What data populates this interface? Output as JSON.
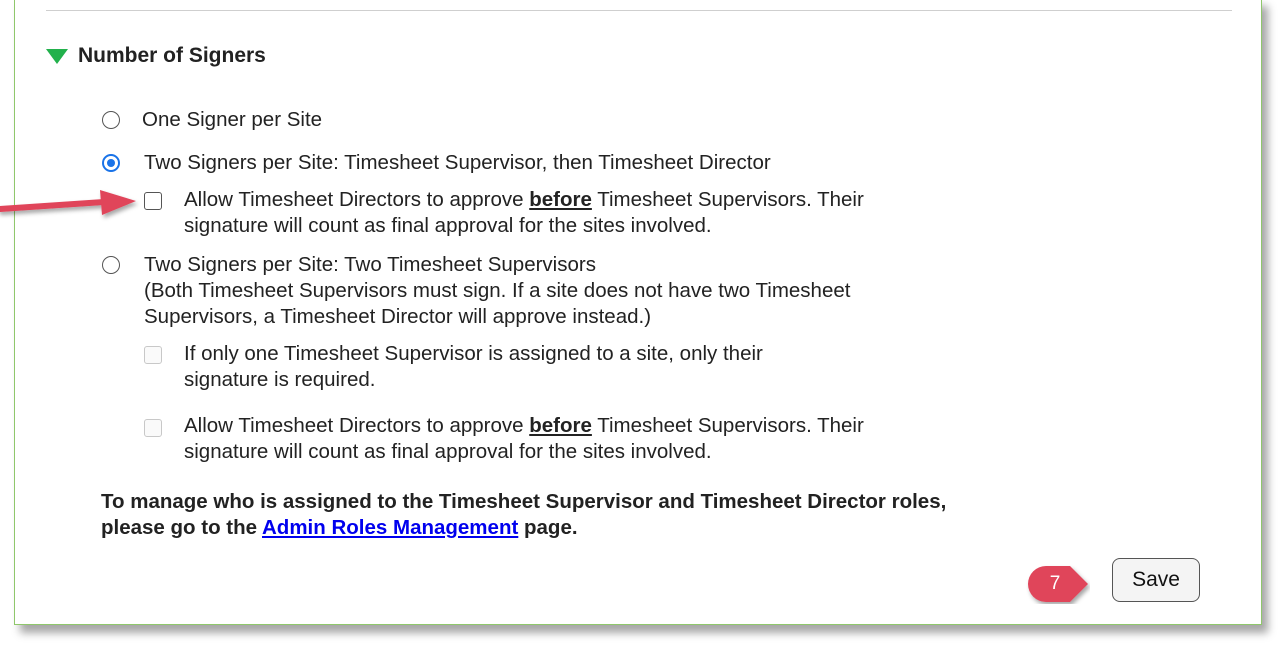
{
  "section": {
    "title": "Number of Signers"
  },
  "options": {
    "one_signer": "One Signer per Site",
    "two_signers_dir": "Two Signers per Site: Timesheet Supervisor, then Timesheet Director",
    "dir_first_a_pre": "Allow Timesheet Directors to approve ",
    "dir_first_a_bold": "before",
    "dir_first_a_post": " Timesheet Supervisors. Their",
    "dir_first_a_line2": "signature will count as final approval for the sites involved.",
    "two_supervisors": "Two Signers per Site: Two Timesheet Supervisors",
    "two_supervisors_note1": "(Both Timesheet Supervisors must sign. If a site does not have two Timesheet",
    "two_supervisors_note2": "Supervisors, a Timesheet Director will approve instead.)",
    "only_one_line1": "If only one Timesheet Supervisor is assigned to a site, only their",
    "only_one_line2": "signature is required.",
    "dir_first_b_pre": "Allow Timesheet Directors to approve ",
    "dir_first_b_bold": "before",
    "dir_first_b_post": " Timesheet Supervisors. Their",
    "dir_first_b_line2": "signature will count as final approval for the sites involved."
  },
  "note": {
    "line1": "To manage who is assigned to the Timesheet Supervisor and Timesheet Director roles,",
    "line2_pre": "please go to the ",
    "link": "Admin Roles Management",
    "line2_post": " page."
  },
  "save_label": "Save",
  "step_badge": "7",
  "colors": {
    "accent": "#1a73e8",
    "annotation": "#e0445a",
    "triangle": "#22b14c",
    "link": "#0000ee"
  }
}
